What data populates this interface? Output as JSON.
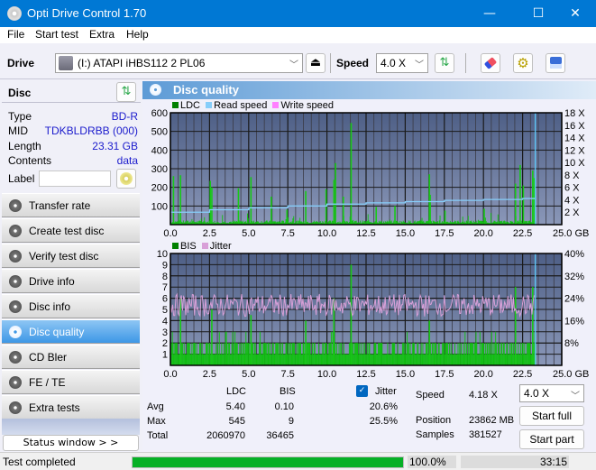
{
  "window": {
    "title": "Opti Drive Control 1.70",
    "controls": {
      "minimize": "—",
      "maximize": "☐",
      "close": "✕"
    }
  },
  "menu": [
    "File",
    "Start test",
    "Extra",
    "Help"
  ],
  "toolbar": {
    "drive_label": "Drive",
    "drive_value": "(I:)  ATAPI iHBS112  2 PL06",
    "speed_label": "Speed",
    "speed_value": "4.0 X",
    "icons": [
      "eject-icon",
      "refresh-icon",
      "erase-icon",
      "settings-icon",
      "save-icon"
    ]
  },
  "disc": {
    "header": "Disc",
    "rows": [
      {
        "key": "Type",
        "value": "BD-R"
      },
      {
        "key": "MID",
        "value": "TDKBLDRBB (000)"
      },
      {
        "key": "Length",
        "value": "23.31 GB"
      },
      {
        "key": "Contents",
        "value": "data"
      }
    ],
    "label_key": "Label",
    "label_value": ""
  },
  "nav": [
    {
      "label": "Transfer rate",
      "active": false
    },
    {
      "label": "Create test disc",
      "active": false
    },
    {
      "label": "Verify test disc",
      "active": false
    },
    {
      "label": "Drive info",
      "active": false
    },
    {
      "label": "Disc info",
      "active": false
    },
    {
      "label": "Disc quality",
      "active": true
    },
    {
      "label": "CD Bler",
      "active": false
    },
    {
      "label": "FE / TE",
      "active": false
    },
    {
      "label": "Extra tests",
      "active": false
    }
  ],
  "status_window_button": "Status window > >",
  "panel_title": "Disc quality",
  "chart_data": [
    {
      "type": "bar",
      "title": "LDC / Read speed",
      "legend": [
        "LDC",
        "Read speed",
        "Write speed"
      ],
      "legend_colors": {
        "LDC": "#008000",
        "Read speed": "#87cefa",
        "Write speed": "#ff80ff"
      },
      "xlabel": "GB",
      "x_range": [
        0,
        25
      ],
      "x_ticks": [
        "0.0",
        "2.5",
        "5.0",
        "7.5",
        "10.0",
        "12.5",
        "15.0",
        "17.5",
        "20.0",
        "22.5",
        "25.0 GB"
      ],
      "ylim_left": [
        0,
        600
      ],
      "y_ticks_left": [
        "600",
        "500",
        "400",
        "300",
        "200",
        "100"
      ],
      "ylim_right": [
        0,
        18
      ],
      "y_ticks_right": [
        "18 X",
        "16 X",
        "14 X",
        "12 X",
        "10 X",
        "8 X",
        "6 X",
        "4 X",
        "2 X"
      ],
      "ldc_peaks": [
        {
          "x": 0.15,
          "y": 260
        },
        {
          "x": 0.6,
          "y": 265
        },
        {
          "x": 2.5,
          "y": 235
        },
        {
          "x": 2.6,
          "y": 200
        },
        {
          "x": 4.3,
          "y": 195
        },
        {
          "x": 5.1,
          "y": 255
        },
        {
          "x": 6.4,
          "y": 150
        },
        {
          "x": 7.4,
          "y": 80
        },
        {
          "x": 8.6,
          "y": 180
        },
        {
          "x": 9.9,
          "y": 190
        },
        {
          "x": 10.4,
          "y": 240
        },
        {
          "x": 10.5,
          "y": 330
        },
        {
          "x": 11.0,
          "y": 150
        },
        {
          "x": 11.5,
          "y": 545
        },
        {
          "x": 13.1,
          "y": 95
        },
        {
          "x": 14.3,
          "y": 100
        },
        {
          "x": 16.5,
          "y": 270
        },
        {
          "x": 16.55,
          "y": 160
        },
        {
          "x": 17.5,
          "y": 75
        },
        {
          "x": 20.0,
          "y": 85
        },
        {
          "x": 22.0,
          "y": 220
        },
        {
          "x": 22.3,
          "y": 320
        },
        {
          "x": 22.5,
          "y": 210
        },
        {
          "x": 23.1,
          "y": 290
        },
        {
          "x": 23.2,
          "y": 250
        }
      ],
      "ldc_baseline": 15,
      "read_speed": [
        {
          "x": 0.0,
          "y": 2.0
        },
        {
          "x": 2.5,
          "y": 2.4
        },
        {
          "x": 5.0,
          "y": 2.7
        },
        {
          "x": 7.5,
          "y": 3.0
        },
        {
          "x": 10.0,
          "y": 3.3
        },
        {
          "x": 12.5,
          "y": 3.5
        },
        {
          "x": 15.0,
          "y": 3.7
        },
        {
          "x": 17.5,
          "y": 3.9
        },
        {
          "x": 20.0,
          "y": 4.05
        },
        {
          "x": 22.5,
          "y": 4.2
        },
        {
          "x": 23.3,
          "y": 4.25
        }
      ],
      "end_marker_x": 23.31
    },
    {
      "type": "bar",
      "title": "BIS / Jitter",
      "legend": [
        "BIS",
        "Jitter"
      ],
      "legend_colors": {
        "BIS": "#008000",
        "Jitter": "#d8a0d8"
      },
      "xlabel": "GB",
      "x_range": [
        0,
        25
      ],
      "x_ticks": [
        "0.0",
        "2.5",
        "5.0",
        "7.5",
        "10.0",
        "12.5",
        "15.0",
        "17.5",
        "20.0",
        "22.5",
        "25.0 GB"
      ],
      "ylim_left": [
        0,
        10
      ],
      "y_ticks_left": [
        "10",
        "9",
        "8",
        "7",
        "6",
        "5",
        "4",
        "3",
        "2",
        "1"
      ],
      "ylim_right": [
        0,
        40
      ],
      "y_ticks_right": [
        "40%",
        "32%",
        "24%",
        "16%",
        "8%"
      ],
      "bis_peaks": [
        {
          "x": 0.6,
          "y": 6
        },
        {
          "x": 2.6,
          "y": 5
        },
        {
          "x": 5.1,
          "y": 4.5
        },
        {
          "x": 8.6,
          "y": 4
        },
        {
          "x": 10.4,
          "y": 6
        },
        {
          "x": 11.5,
          "y": 9
        },
        {
          "x": 16.5,
          "y": 4
        },
        {
          "x": 22.0,
          "y": 7
        },
        {
          "x": 23.1,
          "y": 7
        }
      ],
      "bis_baseline": 1,
      "jitter_percent_range": [
        16,
        25.5
      ],
      "jitter_avg_percent": 20.6,
      "end_marker_x": 23.31
    }
  ],
  "stats": {
    "col_ldc": "LDC",
    "col_bis": "BIS",
    "jitter_label": "Jitter",
    "jitter_checked": true,
    "rows": [
      {
        "key": "Avg",
        "ldc": "5.40",
        "bis": "0.10",
        "jitter": "20.6%"
      },
      {
        "key": "Max",
        "ldc": "545",
        "bis": "9",
        "jitter": "25.5%"
      },
      {
        "key": "Total",
        "ldc": "2060970",
        "bis": "36465",
        "jitter": ""
      }
    ],
    "speed_label": "Speed",
    "speed_value": "4.18 X",
    "position_label": "Position",
    "position_value": "23862 MB",
    "samples_label": "Samples",
    "samples_value": "381527",
    "speed_select": "4.0 X",
    "start_full": "Start full",
    "start_part": "Start part"
  },
  "statusbar": {
    "status": "Test completed",
    "progress_percent": 100.0,
    "progress_text": "100.0%",
    "time": "33:15"
  }
}
